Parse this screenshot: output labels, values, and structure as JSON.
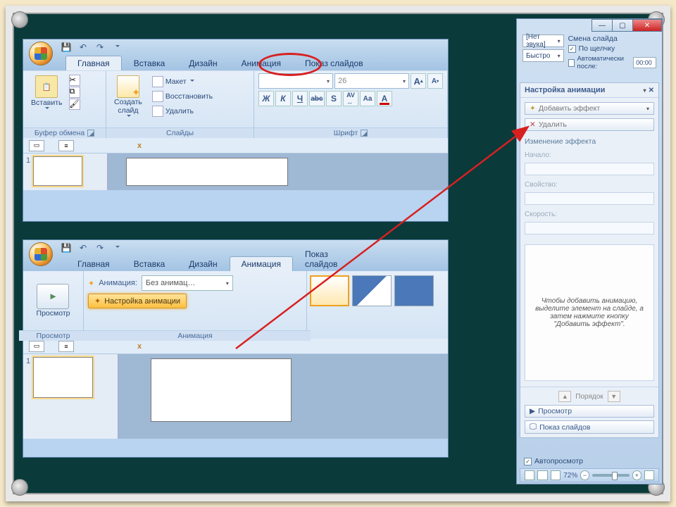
{
  "tabs": {
    "home": "Главная",
    "insert": "Вставка",
    "design": "Дизайн",
    "animation": "Анимация",
    "slideshow": "Показ слайдов"
  },
  "clipboard": {
    "label": "Буфер обмена",
    "paste": "Вставить"
  },
  "slides": {
    "label": "Слайды",
    "new": "Создать\nслайд",
    "layout": "Макет",
    "reset": "Восстановить",
    "delete": "Удалить"
  },
  "font": {
    "label": "Шрифт",
    "size": "26"
  },
  "pp2": {
    "preview_group": "Просмотр",
    "preview_btn": "Просмотр",
    "anim_group": "Анимация",
    "anim_lbl": "Анимация:",
    "anim_val": "Без анимац…",
    "settings": "Настройка анимации"
  },
  "right": {
    "sound_lbl": "[Нет звука]",
    "speed_lbl": "Быстро",
    "change_lbl": "Смена слайда",
    "onclick": "По щелчку",
    "auto_after": "Автоматически после:",
    "auto_time": "00:00",
    "pane_title": "Настройка анимации",
    "add_effect": "Добавить эффект",
    "delete": "Удалить",
    "change_effect": "Изменение эффекта",
    "start": "Начало:",
    "property": "Свойство:",
    "speed": "Скорость:",
    "hint": "Чтобы добавить анимацию, выделите элемент на слайде, а затем нажмите кнопку \"Добавить эффект\".",
    "order": "Порядок",
    "play": "Просмотр",
    "slideshow": "Показ слайдов",
    "autopreview": "Автопросмотр",
    "zoom": "72%"
  },
  "outline": {
    "close": "x"
  },
  "thumb": {
    "num": "1"
  }
}
